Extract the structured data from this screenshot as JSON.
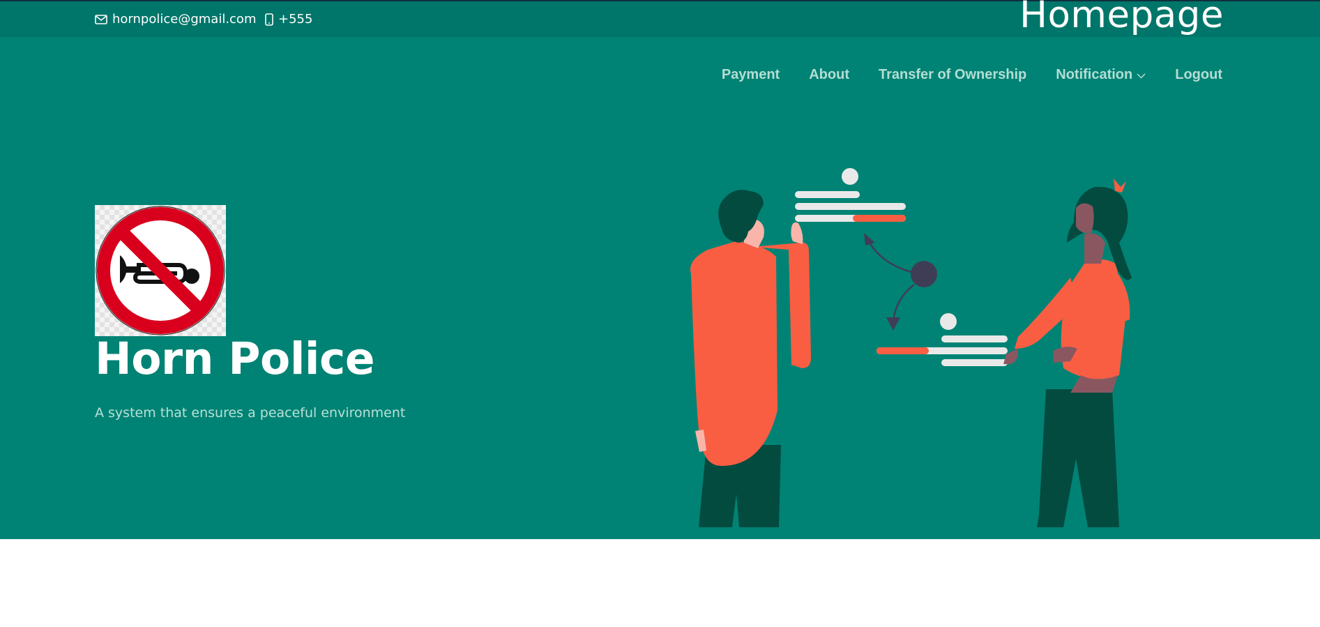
{
  "topbar": {
    "email": "hornpolice@gmail.com",
    "phone": "+555",
    "page_heading": "Homepage"
  },
  "nav": {
    "items": [
      {
        "label": "Payment"
      },
      {
        "label": "About"
      },
      {
        "label": "Transfer of Ownership"
      },
      {
        "label": "Notification",
        "has_dropdown": true
      },
      {
        "label": "Logout"
      }
    ]
  },
  "hero": {
    "logo_icon": "no-horn-sign",
    "title": "Horn Police",
    "tagline": "A system that ensures a peaceful environment",
    "illustration": "two-people-exchanging-data"
  },
  "colors": {
    "topbar_bg": "#00766a",
    "hero_bg": "#008374",
    "accent": "#f95e43",
    "dark_teal": "#034b3f",
    "sign_red": "#d9001d"
  }
}
